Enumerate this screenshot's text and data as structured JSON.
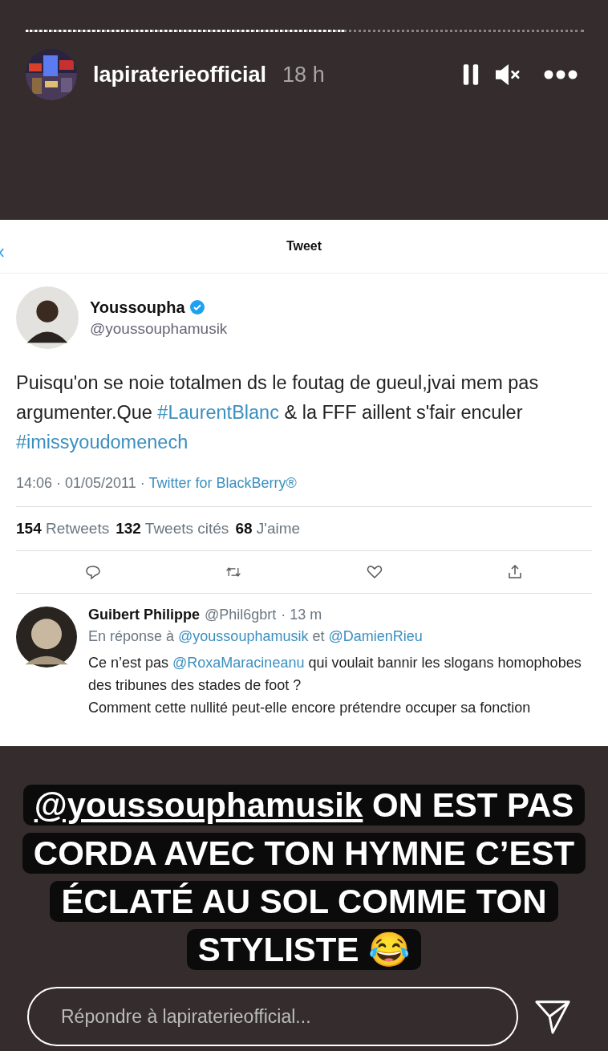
{
  "story": {
    "progress": {
      "level": 0.57
    },
    "account": "lapiraterieofficial",
    "time": "18 h",
    "paused": true,
    "muted": true
  },
  "tweet": {
    "header": "Tweet",
    "author": {
      "name": "Youssoupha",
      "verified": true,
      "handle": "@youssouphamusik"
    },
    "text": [
      {
        "kind": "plain",
        "text": "Puisqu'on se noie totalmen ds le foutag de gueul,jvai mem pas argumenter.Que "
      },
      {
        "kind": "hashtag",
        "text": "#LaurentBlanc"
      },
      {
        "kind": "plain",
        "text": " & la FFF aillent s'fair enculer "
      },
      {
        "kind": "hashtag",
        "text": "#imissyoudomenech"
      }
    ],
    "meta": {
      "time": "14:06 · 01/05/2011 · ",
      "source": "Twitter for BlackBerry®"
    },
    "stats": [
      {
        "count": "154",
        "label": "Retweets"
      },
      {
        "count": "132",
        "label": "Tweets cités"
      },
      {
        "count": "68",
        "label": "J'aime"
      }
    ],
    "reply": {
      "name": "Guibert Philippe",
      "handle": "@Phil6gbrt",
      "time": "· 13 m",
      "reply_to": [
        {
          "kind": "plain",
          "text": "En réponse à "
        },
        {
          "kind": "mention",
          "text": "@youssouphamusik"
        },
        {
          "kind": "plain",
          "text": " et "
        },
        {
          "kind": "mention",
          "text": "@DamienRieu"
        }
      ],
      "body": [
        {
          "kind": "plain",
          "text": "Ce n’est pas "
        },
        {
          "kind": "mention",
          "text": "@RoxaMaracineanu"
        },
        {
          "kind": "plain",
          "text": " qui voulait bannir les slogans homophobes des tribunes des stades de foot ?\nComment cette nullité peut-elle encore prétendre occuper sa fonction"
        }
      ]
    }
  },
  "caption": {
    "mention": "@youssouphamusik",
    "text": " ON EST PAS CORDA AVEC TON HYMNE C’EST ÉCLATÉ AU SOL COMME TON STYLISTE 😂"
  },
  "reply_field": {
    "placeholder": "Répondre à lapiraterieofficial..."
  }
}
